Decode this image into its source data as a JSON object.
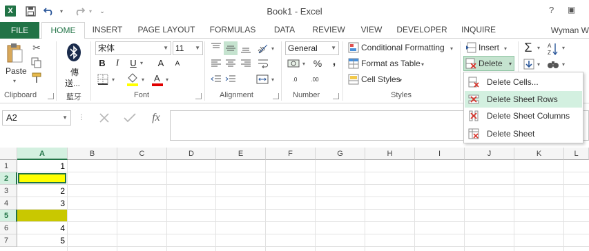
{
  "app": {
    "title": "Book1 - Excel",
    "logo_letter": "X"
  },
  "window_buttons": {
    "help": "?",
    "restore": "▣"
  },
  "tabs": {
    "file": "FILE",
    "items": [
      "HOME",
      "INSERT",
      "PAGE LAYOUT",
      "FORMULAS",
      "DATA",
      "REVIEW",
      "VIEW",
      "DEVELOPER",
      "INQUIRE"
    ],
    "active": "HOME",
    "user": "Wyman W"
  },
  "ribbon": {
    "clipboard": {
      "paste": "Paste",
      "label": "Clipboard"
    },
    "bluetooth": {
      "line1": "傳",
      "line2": "送...",
      "label": "藍牙"
    },
    "font": {
      "name": "宋体",
      "size": "11",
      "bold": "B",
      "italic": "I",
      "underline": "U",
      "grow": "A",
      "shrink": "A",
      "label": "Font"
    },
    "alignment": {
      "label": "Alignment"
    },
    "number": {
      "format": "General",
      "currency": "$",
      "percent": "%",
      "comma": ",",
      "inc_decimal": ".00",
      "dec_decimal": ".0",
      "label": "Number"
    },
    "styles": {
      "conditional": "Conditional Formatting",
      "format_table": "Format as Table",
      "cell_styles": "Cell Styles",
      "label": "Styles"
    },
    "cells": {
      "insert": "Insert",
      "delete": "Delete"
    },
    "editing": {
      "sum": "Σ",
      "sort": "A Z"
    }
  },
  "formula_bar": {
    "name_box": "A2",
    "fx": "fx",
    "value": ""
  },
  "columns": [
    "A",
    "B",
    "C",
    "D",
    "E",
    "F",
    "G",
    "H",
    "I",
    "J",
    "K",
    "L"
  ],
  "rows": [
    "1",
    "2",
    "3",
    "4",
    "5",
    "6",
    "7"
  ],
  "cells": [
    {
      "ref": "A1",
      "value": "1"
    },
    {
      "ref": "A3",
      "value": "2"
    },
    {
      "ref": "A4",
      "value": "3"
    },
    {
      "ref": "A6",
      "value": "4"
    },
    {
      "ref": "A7",
      "value": "5"
    }
  ],
  "colors": {
    "accent": "#217346",
    "yellow_row2": "#ffff00",
    "yellow_row5": "#c9c800"
  },
  "delete_menu": {
    "items": [
      "Delete Cells...",
      "Delete Sheet Rows",
      "Delete Sheet Columns",
      "Delete Sheet"
    ],
    "hovered": "Delete Sheet Rows"
  }
}
